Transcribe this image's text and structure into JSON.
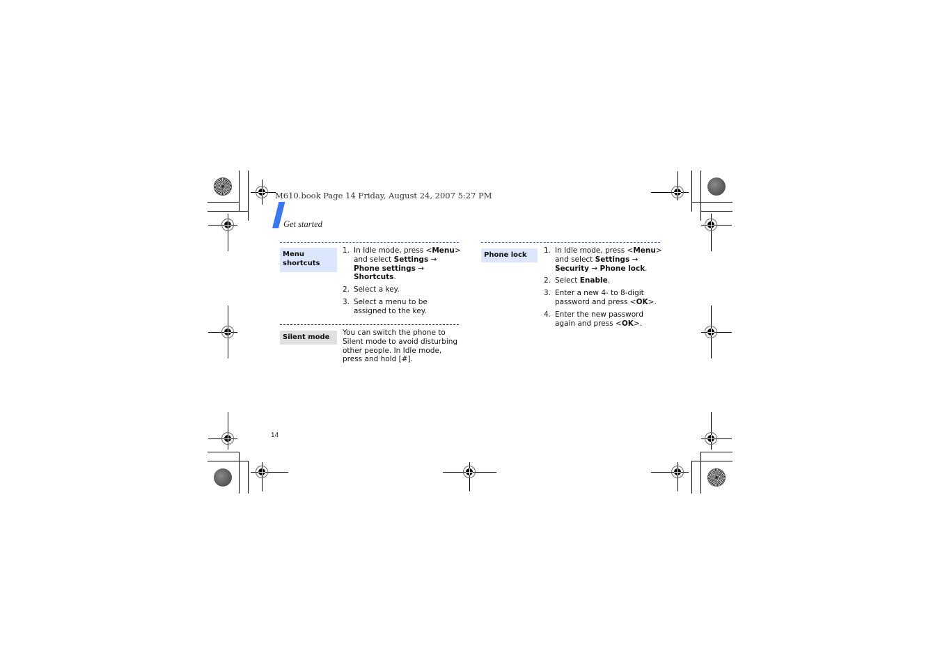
{
  "header": {
    "print_line": "M610.book  Page 14  Friday, August 24, 2007  5:27 PM",
    "section_title": "Get started",
    "accent_color": "#3b78f0"
  },
  "sections": [
    {
      "label": "Menu shortcuts",
      "label_bg": "#dce6fc",
      "steps": [
        {
          "num": "1.",
          "parts": [
            "In Idle mode, press <",
            {
              "b": "Menu"
            },
            "> and select ",
            {
              "b": "Settings"
            },
            " → ",
            {
              "b": "Phone settings"
            },
            " → ",
            {
              "b": "Shortcuts"
            },
            "."
          ]
        },
        {
          "num": "2.",
          "parts": [
            "Select a key."
          ]
        },
        {
          "num": "3.",
          "parts": [
            "Select a menu to be assigned to the key."
          ]
        }
      ]
    },
    {
      "label": "Silent mode",
      "label_bg": "#e0e0e0",
      "paragraph": "You can switch the phone to Silent mode to avoid disturbing other people. In Idle mode, press and hold [#]."
    },
    {
      "label": "Phone lock",
      "label_bg": "#dce6fc",
      "steps": [
        {
          "num": "1.",
          "parts": [
            "In Idle mode, press <",
            {
              "b": "Menu"
            },
            "> and select ",
            {
              "b": "Settings"
            },
            " → ",
            {
              "b": "Security"
            },
            " → ",
            {
              "b": "Phone lock"
            },
            "."
          ]
        },
        {
          "num": "2.",
          "parts": [
            "Select ",
            {
              "b": "Enable"
            },
            "."
          ]
        },
        {
          "num": "3.",
          "parts": [
            "Enter a new 4- to 8-digit password and press <",
            {
              "b": "OK"
            },
            ">."
          ]
        },
        {
          "num": "4.",
          "parts": [
            "Enter the new password again and press <",
            {
              "b": "OK"
            },
            ">."
          ]
        }
      ]
    }
  ],
  "footer": {
    "page_number": "14"
  }
}
